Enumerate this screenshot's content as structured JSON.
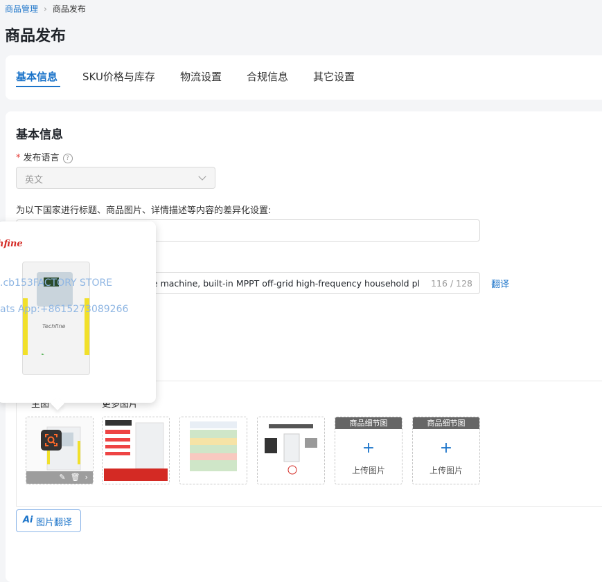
{
  "breadcrumb": {
    "parent": "商品管理",
    "current": "商品发布"
  },
  "page_title": "商品发布",
  "tabs": [
    {
      "label": "基本信息",
      "active": true
    },
    {
      "label": "SKU价格与库存",
      "active": false
    },
    {
      "label": "物流设置",
      "active": false
    },
    {
      "label": "合规信息",
      "active": false
    },
    {
      "label": "其它设置",
      "active": false
    }
  ],
  "basic": {
    "section_title": "基本信息",
    "language_label": "发布语言",
    "required_mark": "*",
    "help_glyph": "?",
    "language_value": "英文",
    "diff_label": "为以下国家进行标题、商品图片、详情描述等内容的差异化设置:",
    "title_value": "ne machine, built-in MPPT off-grid high-frequency household pl",
    "title_count": "116 / 128",
    "translate_link": "翻译"
  },
  "images": {
    "main_label": "主图",
    "more_label": "更多图片",
    "detail_header": "商品细节图",
    "upload_plus": "+",
    "upload_label": "上传图片"
  },
  "ai_translate": {
    "ai_label": "Ai",
    "label": "图片翻译"
  },
  "popover": {
    "brand": "hfine",
    "watermark_store": ".cb153FACTORY STORE",
    "watermark_app": "ats App:+8615273089266",
    "device_brand": "Techfine"
  },
  "colors": {
    "accent": "#1a73c9",
    "required": "#e53935",
    "brand_red": "#d42a24",
    "device_yellow": "#f1e02a"
  }
}
